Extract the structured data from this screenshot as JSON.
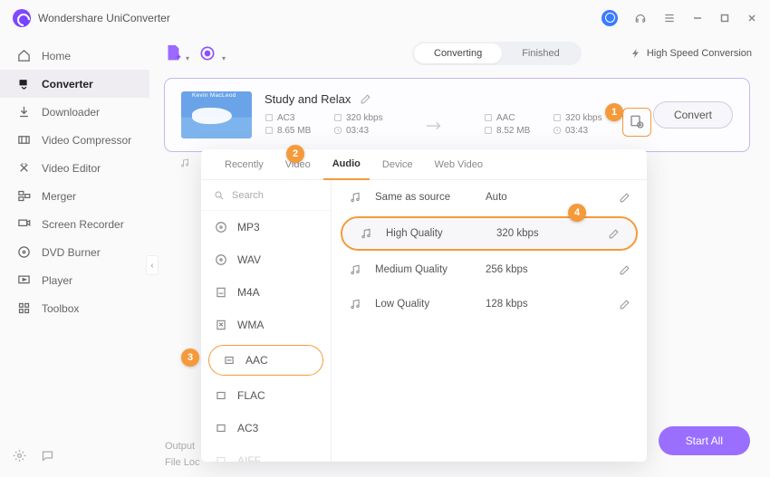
{
  "app": {
    "title": "Wondershare UniConverter"
  },
  "titlebar_icons": [
    "user-avatar",
    "headset-icon",
    "menu-icon",
    "minimize-icon",
    "maximize-icon",
    "close-icon"
  ],
  "sidebar": {
    "items": [
      {
        "label": "Home",
        "icon": "home-icon"
      },
      {
        "label": "Converter",
        "icon": "converter-icon",
        "active": true
      },
      {
        "label": "Downloader",
        "icon": "downloader-icon"
      },
      {
        "label": "Video Compressor",
        "icon": "compressor-icon"
      },
      {
        "label": "Video Editor",
        "icon": "editor-icon"
      },
      {
        "label": "Merger",
        "icon": "merger-icon"
      },
      {
        "label": "Screen Recorder",
        "icon": "recorder-icon"
      },
      {
        "label": "DVD Burner",
        "icon": "dvd-icon"
      },
      {
        "label": "Player",
        "icon": "player-icon"
      },
      {
        "label": "Toolbox",
        "icon": "toolbox-icon"
      }
    ]
  },
  "toolbar": {
    "tabs": {
      "converting": "Converting",
      "finished": "Finished",
      "active": "converting"
    },
    "hsc_label": "High Speed Conversion"
  },
  "file": {
    "thumb_label": "Kevin MacLeod",
    "title": "Study and Relax",
    "source": {
      "codec": "AC3",
      "bitrate": "320 kbps",
      "size": "8.65 MB",
      "duration": "03:43"
    },
    "target": {
      "codec": "AAC",
      "bitrate": "320 kbps",
      "size": "8.52 MB",
      "duration": "03:43"
    },
    "convert_label": "Convert"
  },
  "popover": {
    "tabs": [
      "Recently",
      "Video",
      "Audio",
      "Device",
      "Web Video"
    ],
    "active_tab": "Audio",
    "search_placeholder": "Search",
    "formats": [
      "MP3",
      "WAV",
      "M4A",
      "WMA",
      "AAC",
      "FLAC",
      "AC3",
      "AIFF"
    ],
    "selected_format": "AAC",
    "qualities": [
      {
        "label": "Same as source",
        "value": "Auto"
      },
      {
        "label": "High Quality",
        "value": "320 kbps",
        "highlight": true
      },
      {
        "label": "Medium Quality",
        "value": "256 kbps"
      },
      {
        "label": "Low Quality",
        "value": "128 kbps"
      }
    ]
  },
  "callouts": {
    "c1": "1",
    "c2": "2",
    "c3": "3",
    "c4": "4"
  },
  "footer": {
    "output": "Output",
    "file_loc": "File Loc",
    "start_all": "Start All"
  }
}
